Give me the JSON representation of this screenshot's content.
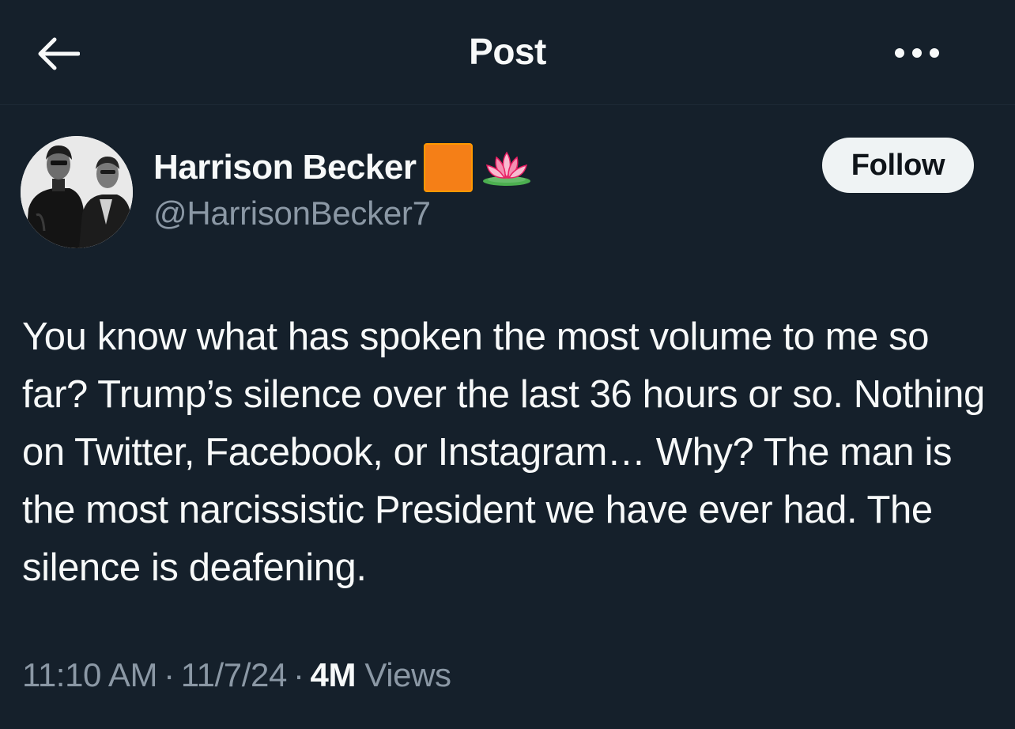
{
  "header": {
    "title": "Post",
    "back_icon": "arrow-left-icon",
    "more_icon": "more-horizontal-icon"
  },
  "author": {
    "display_name": "Harrison Becker",
    "emoji_square": "🟧",
    "emoji_lotus": "🪷",
    "handle": "@HarrisonBecker7",
    "follow_label": "Follow"
  },
  "post": {
    "text": "You know what has spoken the most volume to me so far? Trump’s silence over the last 36 hours or so. Nothing on Twitter, Facebook, or Instagram… Why? The man is the most narcissistic President we have ever had. The silence is deafening."
  },
  "meta": {
    "time": "11:10 AM",
    "separator": "·",
    "date": "11/7/24",
    "views_count": "4M",
    "views_label": "Views"
  },
  "colors": {
    "background": "#15202b",
    "primary_text": "#f7f9f9",
    "secondary_text": "#8b98a5",
    "follow_button_bg": "#eff3f4",
    "square_emoji": "#f57f17",
    "lotus_emoji": "#f48fb1"
  }
}
